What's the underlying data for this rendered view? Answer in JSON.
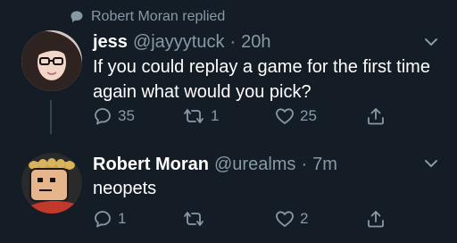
{
  "context": {
    "replied_label": "Robert Moran replied"
  },
  "tweets": [
    {
      "name": "jess",
      "handle": "@jayyytuck",
      "separator": "·",
      "time": "20h",
      "text": "If you could replay a game for the first time again what would you pick?",
      "actions": {
        "reply_count": "35",
        "retweet_count": "1",
        "like_count": "25"
      }
    },
    {
      "name": "Robert Moran",
      "handle": "@urealms",
      "separator": "·",
      "time": "7m",
      "text": "neopets",
      "actions": {
        "reply_count": "1",
        "retweet_count": "",
        "like_count": "2"
      }
    }
  ],
  "colors": {
    "background": "#141d26",
    "text": "#ffffff",
    "muted": "#8899a6",
    "thread_line": "#38444d"
  },
  "icons": [
    "speech-bubble-icon",
    "chevron-down-icon",
    "reply-icon",
    "retweet-icon",
    "like-icon",
    "share-icon"
  ]
}
